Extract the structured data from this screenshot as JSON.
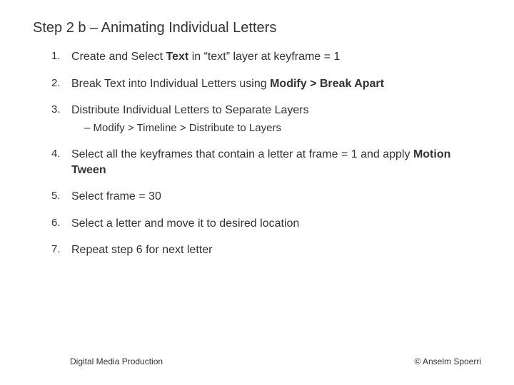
{
  "title": "Step 2 b – Animating Individual Letters",
  "steps": [
    {
      "num": "1.",
      "parts": [
        {
          "t": "Create and Select ",
          "b": false
        },
        {
          "t": "Text",
          "b": true
        },
        {
          "t": " in “text” layer at keyframe = 1",
          "b": false
        }
      ]
    },
    {
      "num": "2.",
      "parts": [
        {
          "t": "Break Text into Individual Letters using ",
          "b": false
        },
        {
          "t": "Modify > Break Apart",
          "b": true
        }
      ]
    },
    {
      "num": "3.",
      "parts": [
        {
          "t": "Distribute Individual Letters to Separate Layers",
          "b": false
        }
      ],
      "sub": "–  Modify > Timeline > Distribute to Layers"
    },
    {
      "num": "4.",
      "parts": [
        {
          "t": "Select all the keyframes that contain a letter at frame = 1 and apply ",
          "b": false
        },
        {
          "t": "Motion Tween",
          "b": true
        }
      ]
    },
    {
      "num": "5.",
      "parts": [
        {
          "t": "Select frame = 30",
          "b": false
        }
      ]
    },
    {
      "num": "6.",
      "parts": [
        {
          "t": "Select a letter and move it to desired location",
          "b": false
        }
      ]
    },
    {
      "num": "7.",
      "parts": [
        {
          "t": "Repeat step 6 for next letter",
          "b": false
        }
      ]
    }
  ],
  "footer": {
    "left": "Digital Media Production",
    "right": "© Anselm Spoerri"
  }
}
